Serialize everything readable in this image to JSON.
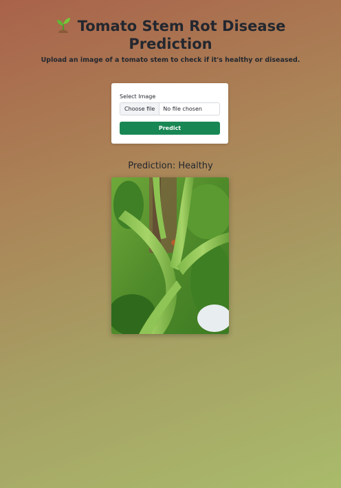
{
  "header": {
    "title_line1": "Tomato Stem Rot Disease",
    "title_line2": "Prediction",
    "icon": "seedling-icon",
    "subtitle": "Upload an image of a tomato stem to check if it's healthy or diseased."
  },
  "form": {
    "label": "Select Image",
    "file_button_label": "Choose file",
    "file_status": "No file chosen",
    "predict_label": "Predict"
  },
  "result": {
    "prediction_text": "Prediction: Healthy"
  },
  "colors": {
    "accent": "#198754"
  }
}
